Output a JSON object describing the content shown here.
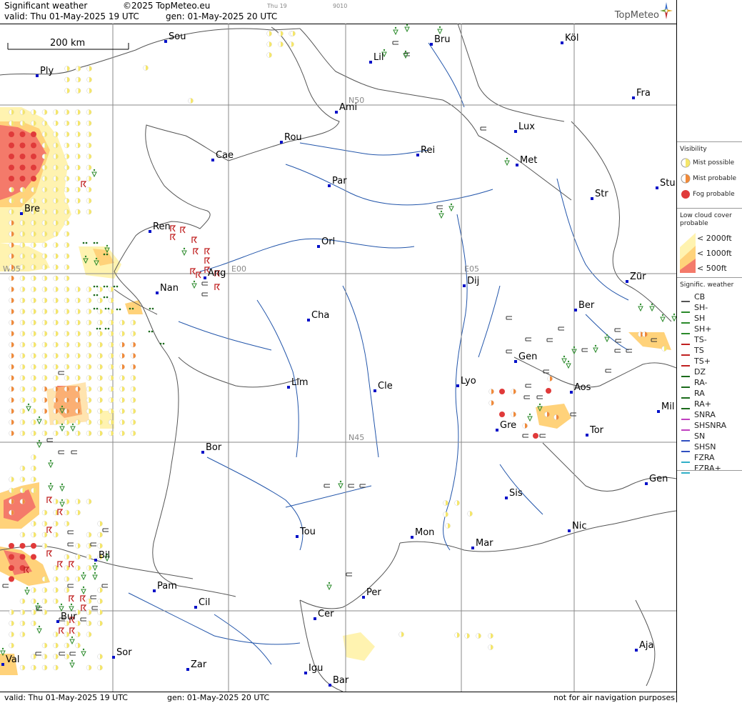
{
  "header": {
    "title": "Significant weather",
    "copyright": "©2025 TopMeteo.eu",
    "valid": "valid:  Thu   01-May-2025  19 UTC",
    "generated": "gen:  01-May-2025  20 UTC",
    "tab_day": "Thu 19",
    "tab_code": "9010",
    "logo": "TopMeteo"
  },
  "footer": {
    "valid": "valid:  Thu   01-May-2025   19 UTC",
    "generated": "gen:  01-May-2025  20 UTC",
    "disclaimer": "not for air navigation purposes"
  },
  "scale_bar": {
    "label": "200 km"
  },
  "grid_labels": {
    "n50": "N50",
    "n45": "N45",
    "w05": "W05",
    "e00": "E00",
    "e05": "E05"
  },
  "cities": [
    {
      "name": "Sou"
    },
    {
      "name": "Bru"
    },
    {
      "name": "Köl"
    },
    {
      "name": "Ply"
    },
    {
      "name": "Lil"
    },
    {
      "name": "Ami"
    },
    {
      "name": "Fra"
    },
    {
      "name": "Lux"
    },
    {
      "name": "Rou"
    },
    {
      "name": "Cae"
    },
    {
      "name": "Rei"
    },
    {
      "name": "Met"
    },
    {
      "name": "Par"
    },
    {
      "name": "Bre"
    },
    {
      "name": "Str"
    },
    {
      "name": "Stu"
    },
    {
      "name": "Ren"
    },
    {
      "name": "Orl"
    },
    {
      "name": "Ang"
    },
    {
      "name": "Nan"
    },
    {
      "name": "Dij"
    },
    {
      "name": "Zür"
    },
    {
      "name": "Cha"
    },
    {
      "name": "Ber"
    },
    {
      "name": "Gen"
    },
    {
      "name": "Lim"
    },
    {
      "name": "Cle"
    },
    {
      "name": "Lyo"
    },
    {
      "name": "Aos"
    },
    {
      "name": "Mil"
    },
    {
      "name": "Gre"
    },
    {
      "name": "Tor"
    },
    {
      "name": "Bor"
    },
    {
      "name": "Gen"
    },
    {
      "name": "Sis"
    },
    {
      "name": "Tou"
    },
    {
      "name": "Mon"
    },
    {
      "name": "Nic"
    },
    {
      "name": "Mar"
    },
    {
      "name": "Bil"
    },
    {
      "name": "Pam"
    },
    {
      "name": "Per"
    },
    {
      "name": "Cil"
    },
    {
      "name": "Cer"
    },
    {
      "name": "Bur"
    },
    {
      "name": "Sor"
    },
    {
      "name": "Aja"
    },
    {
      "name": "Val"
    },
    {
      "name": "Zar"
    },
    {
      "name": "Igu"
    },
    {
      "name": "Bar"
    }
  ],
  "legend": {
    "visibility_title": "Visibility",
    "mist_possible": "Mist possible",
    "mist_probable": "Mist probable",
    "fog_probable": "Fog probable",
    "low_cloud_title": "Low cloud cover probable",
    "lc_2000": "< 2000ft",
    "lc_1000": "< 1000ft",
    "lc_500": "<  500ft",
    "signif_title": "Signific. weather",
    "items": [
      "CB",
      "SH-",
      "SH",
      "SH+",
      "TS-",
      "TS",
      "TS+",
      "DZ",
      "RA-",
      "RA",
      "RA+",
      "SNRA",
      "SHSNRA",
      "SN",
      "SHSN",
      "FZRA",
      "FZRA+"
    ],
    "colors": {
      "mist_possible": "#f5e66a",
      "mist_probable": "#f08a3a",
      "fog_probable": "#e03a3a",
      "lc_2000": "#fff3b0",
      "lc_1000": "#ffd27a",
      "lc_500": "#f47a6a"
    }
  }
}
